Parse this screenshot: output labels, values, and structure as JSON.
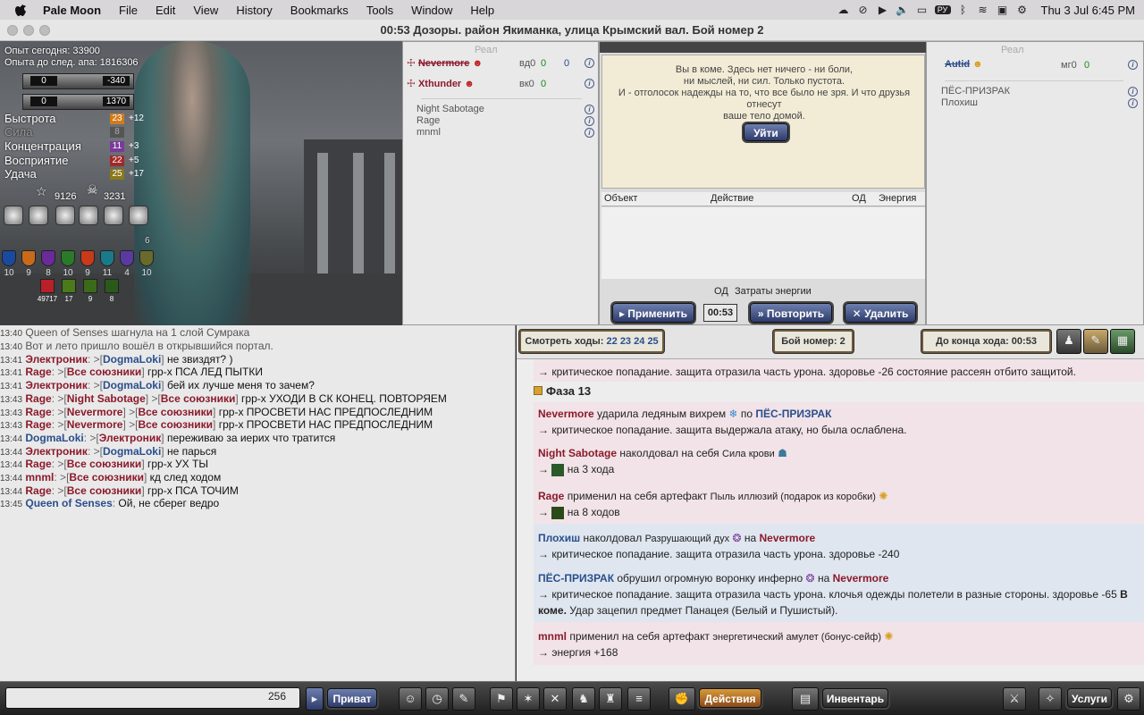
{
  "menubar": {
    "app_name": "Pale Moon",
    "items": [
      "File",
      "Edit",
      "View",
      "History",
      "Bookmarks",
      "Tools",
      "Window",
      "Help"
    ],
    "input_lang": "РУ",
    "datetime": "Thu 3 Jul  6:45 PM"
  },
  "window": {
    "title": "00:53 Дозоры. район Якиманка, улица Крымский вал. Бой номер 2"
  },
  "character": {
    "exp_today": "Опыт сегодня: 33900",
    "exp_to_next": "Опыта до след. апа: 1816306",
    "hp_left": "0",
    "hp_right": "-340",
    "mp_left": "0",
    "mp_right": "1370",
    "stats": [
      {
        "label": "Быстрота",
        "value": "23",
        "bonus": "+12"
      },
      {
        "label": "Сила",
        "value": "8",
        "bonus": ""
      },
      {
        "label": "Концентрация",
        "value": "11",
        "bonus": "+3"
      },
      {
        "label": "Восприятие",
        "value": "22",
        "bonus": "+5"
      },
      {
        "label": "Удача",
        "value": "25",
        "bonus": "+17"
      }
    ],
    "rank_value": "9126",
    "kills_value": "3231",
    "shield_top": "6",
    "shields": [
      "10",
      "9",
      "8",
      "10",
      "9",
      "11",
      "4",
      "10"
    ],
    "buffs": [
      "49717",
      "17",
      "9",
      "8"
    ]
  },
  "left_team": {
    "header": "Реал",
    "fighters": [
      {
        "name": "Nevermore",
        "stat": "вд0",
        "v1": "0",
        "v2": "0"
      },
      {
        "name": "Xthunder",
        "stat": "вк0",
        "v1": "0",
        "v2": ""
      }
    ],
    "allies": [
      "Night Sabotage",
      "Rage",
      "mnml"
    ]
  },
  "coma": {
    "text1": "Вы в коме. Здесь нет ничего - ни боли,",
    "text2": "ни мыслей, ни сил. Только пустота.",
    "text3": "И - отголосок надежды на то, что все было не зря. И что друзья отнесут",
    "text4": "ваше тело домой.",
    "leave": "Уйти"
  },
  "actions": {
    "headers": [
      "Объект",
      "Действие",
      "ОД",
      "Энергия"
    ],
    "od_label": "ОД",
    "energy_label": "Затраты энергии",
    "apply": "Применить",
    "timer": "00:53",
    "repeat": "Повторить",
    "delete": "Удалить"
  },
  "right_team": {
    "header": "Реал",
    "fighters": [
      {
        "name": "Autid",
        "stat": "мг0",
        "v1": "0"
      }
    ],
    "allies": [
      "ПЁС-ПРИЗРАК",
      "Плохиш"
    ]
  },
  "chat": [
    {
      "time": "13:40",
      "text": "Queen of Senses шагнула на 1 слой Сумрака"
    },
    {
      "time": "13:40",
      "text": "Вот и лето пришло вошёл в открывшийся портал."
    },
    {
      "time": "13:41",
      "name": "Электроник",
      "to": "DogmaLoki",
      "msg": "не звиздят? )"
    },
    {
      "time": "13:41",
      "name": "Rage",
      "to": "Все союзники",
      "msg": "грр-х ПСА ЛЕД ПЫТКИ"
    },
    {
      "time": "13:41",
      "name": "Электроник",
      "to": "DogmaLoki",
      "msg": "бей их лучше меня то зачем?"
    },
    {
      "time": "13:43",
      "name": "Rage",
      "to": "Night Sabotage",
      "to2": "Все союзники",
      "msg": "грр-х УХОДИ В СК КОНЕЦ. ПОВТОРЯЕМ"
    },
    {
      "time": "13:43",
      "name": "Rage",
      "to": "Nevermore",
      "to2": "Все союзники",
      "msg": "грр-х ПРОСВЕТИ НАС ПРЕДПОСЛЕДНИМ"
    },
    {
      "time": "13:43",
      "name": "Rage",
      "to": "Nevermore",
      "to2": "Все союзники",
      "msg": "грр-х ПРОСВЕТИ НАС ПРЕДПОСЛЕДНИМ"
    },
    {
      "time": "13:44",
      "name": "DogmaLoki",
      "to": "Электроник",
      "msg": "переживаю за иерих что тратится"
    },
    {
      "time": "13:44",
      "name": "Электроник",
      "to": "DogmaLoki",
      "msg": "не парься"
    },
    {
      "time": "13:44",
      "name": "Rage",
      "to": "Все союзники",
      "msg": "грр-х УХ ТЫ"
    },
    {
      "time": "13:44",
      "name": "mnml",
      "to": "Все союзники",
      "msg": "кд след ходом"
    },
    {
      "time": "13:44",
      "name": "Rage",
      "to": "Все союзники",
      "msg": "грр-х ПСА ТОЧИМ"
    },
    {
      "time": "13:45",
      "name": "Queen of Senses",
      "msg": "Ой, не сберег ведро"
    }
  ],
  "log_header": {
    "view_moves": "Смотреть ходы:",
    "moves": [
      "22",
      "23",
      "24",
      "25"
    ],
    "battle_no": "Бой номер: 2",
    "turn_end": "До конца хода: 00:53"
  },
  "log": {
    "top_line": "→ критическое попадание. защита отразила часть урона. здоровье -26 состояние рассеян отбито защитой.",
    "phase": "Фаза 13",
    "e1_actor": "Nevermore",
    "e1_act": "ударила ледяным вихрем",
    "e1_by": "по",
    "e1_target": "ПЁС-ПРИЗРАК",
    "e1_res": "→ критическое попадание. защита выдержала атаку, но была ослаблена.",
    "e2_actor": "Night Sabotage",
    "e2_act": "наколдовал на себя",
    "e2_spell": "Сила крови",
    "e2_res": "на 3 хода",
    "e3_actor": "Rage",
    "e3_act": "применил на себя артефакт",
    "e3_item": "Пыль иллюзий (подарок из коробки)",
    "e3_res": "на 8 ходов",
    "e4_actor": "Плохиш",
    "e4_act": "наколдовал",
    "e4_spell": "Разрушающий дух",
    "e4_on": "на",
    "e4_target": "Nevermore",
    "e4_res": "→ критическое попадание. защита отразила часть урона. здоровье -240",
    "e5_actor": "ПЁС-ПРИЗРАК",
    "e5_act": "обрушил огромную воронку инферно",
    "e5_on": "на",
    "e5_target": "Nevermore",
    "e5_res1": "→ критическое попадание. защита отразила часть урона. клочья одежды полетели в разные стороны. здоровье -65",
    "e5_bold1": "В",
    "e5_bold2": "коме.",
    "e5_res2": "Удар зацепил предмет Панацея (Белый и Пушистый).",
    "e6_actor": "mnml",
    "e6_act": "применил на себя артефакт",
    "e6_item": "энергетический амулет (бонус-сейф)",
    "e6_res": "→ энергия +168"
  },
  "bottom": {
    "chat_count": "256",
    "private": "Приват",
    "actions": "Действия",
    "inventory": "Инвентарь",
    "services": "Услуги"
  }
}
